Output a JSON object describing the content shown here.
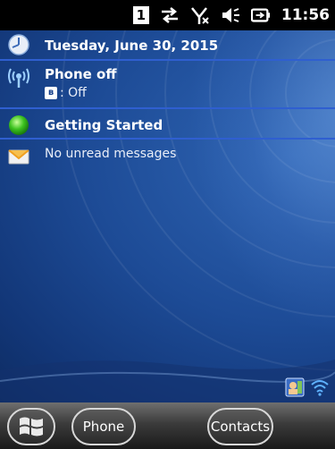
{
  "status_bar": {
    "notification_count": "1",
    "icons": [
      "sync-arrows-icon",
      "no-signal-icon",
      "speaker-icon",
      "battery-charging-icon"
    ],
    "time": "11:56"
  },
  "today": {
    "date": "Tuesday, June 30, 2015",
    "phone": {
      "title": "Phone off",
      "bluetooth_status": ": Off"
    },
    "getting_started": "Getting Started",
    "messages": "No unread messages"
  },
  "softkeys": {
    "left": "Phone",
    "right": "Contacts"
  },
  "colors": {
    "separator": "#2f5fd0",
    "background": "#1d4b96"
  }
}
